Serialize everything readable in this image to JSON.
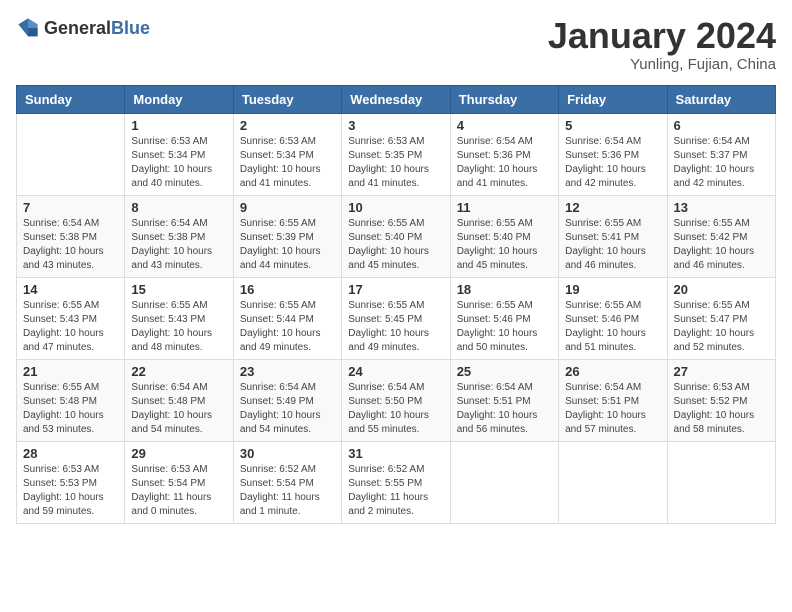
{
  "logo": {
    "general": "General",
    "blue": "Blue"
  },
  "title": "January 2024",
  "subtitle": "Yunling, Fujian, China",
  "header_days": [
    "Sunday",
    "Monday",
    "Tuesday",
    "Wednesday",
    "Thursday",
    "Friday",
    "Saturday"
  ],
  "weeks": [
    [
      {
        "day": "",
        "sunrise": "",
        "sunset": "",
        "daylight": ""
      },
      {
        "day": "1",
        "sunrise": "Sunrise: 6:53 AM",
        "sunset": "Sunset: 5:34 PM",
        "daylight": "Daylight: 10 hours and 40 minutes."
      },
      {
        "day": "2",
        "sunrise": "Sunrise: 6:53 AM",
        "sunset": "Sunset: 5:34 PM",
        "daylight": "Daylight: 10 hours and 41 minutes."
      },
      {
        "day": "3",
        "sunrise": "Sunrise: 6:53 AM",
        "sunset": "Sunset: 5:35 PM",
        "daylight": "Daylight: 10 hours and 41 minutes."
      },
      {
        "day": "4",
        "sunrise": "Sunrise: 6:54 AM",
        "sunset": "Sunset: 5:36 PM",
        "daylight": "Daylight: 10 hours and 41 minutes."
      },
      {
        "day": "5",
        "sunrise": "Sunrise: 6:54 AM",
        "sunset": "Sunset: 5:36 PM",
        "daylight": "Daylight: 10 hours and 42 minutes."
      },
      {
        "day": "6",
        "sunrise": "Sunrise: 6:54 AM",
        "sunset": "Sunset: 5:37 PM",
        "daylight": "Daylight: 10 hours and 42 minutes."
      }
    ],
    [
      {
        "day": "7",
        "sunrise": "Sunrise: 6:54 AM",
        "sunset": "Sunset: 5:38 PM",
        "daylight": "Daylight: 10 hours and 43 minutes."
      },
      {
        "day": "8",
        "sunrise": "Sunrise: 6:54 AM",
        "sunset": "Sunset: 5:38 PM",
        "daylight": "Daylight: 10 hours and 43 minutes."
      },
      {
        "day": "9",
        "sunrise": "Sunrise: 6:55 AM",
        "sunset": "Sunset: 5:39 PM",
        "daylight": "Daylight: 10 hours and 44 minutes."
      },
      {
        "day": "10",
        "sunrise": "Sunrise: 6:55 AM",
        "sunset": "Sunset: 5:40 PM",
        "daylight": "Daylight: 10 hours and 45 minutes."
      },
      {
        "day": "11",
        "sunrise": "Sunrise: 6:55 AM",
        "sunset": "Sunset: 5:40 PM",
        "daylight": "Daylight: 10 hours and 45 minutes."
      },
      {
        "day": "12",
        "sunrise": "Sunrise: 6:55 AM",
        "sunset": "Sunset: 5:41 PM",
        "daylight": "Daylight: 10 hours and 46 minutes."
      },
      {
        "day": "13",
        "sunrise": "Sunrise: 6:55 AM",
        "sunset": "Sunset: 5:42 PM",
        "daylight": "Daylight: 10 hours and 46 minutes."
      }
    ],
    [
      {
        "day": "14",
        "sunrise": "Sunrise: 6:55 AM",
        "sunset": "Sunset: 5:43 PM",
        "daylight": "Daylight: 10 hours and 47 minutes."
      },
      {
        "day": "15",
        "sunrise": "Sunrise: 6:55 AM",
        "sunset": "Sunset: 5:43 PM",
        "daylight": "Daylight: 10 hours and 48 minutes."
      },
      {
        "day": "16",
        "sunrise": "Sunrise: 6:55 AM",
        "sunset": "Sunset: 5:44 PM",
        "daylight": "Daylight: 10 hours and 49 minutes."
      },
      {
        "day": "17",
        "sunrise": "Sunrise: 6:55 AM",
        "sunset": "Sunset: 5:45 PM",
        "daylight": "Daylight: 10 hours and 49 minutes."
      },
      {
        "day": "18",
        "sunrise": "Sunrise: 6:55 AM",
        "sunset": "Sunset: 5:46 PM",
        "daylight": "Daylight: 10 hours and 50 minutes."
      },
      {
        "day": "19",
        "sunrise": "Sunrise: 6:55 AM",
        "sunset": "Sunset: 5:46 PM",
        "daylight": "Daylight: 10 hours and 51 minutes."
      },
      {
        "day": "20",
        "sunrise": "Sunrise: 6:55 AM",
        "sunset": "Sunset: 5:47 PM",
        "daylight": "Daylight: 10 hours and 52 minutes."
      }
    ],
    [
      {
        "day": "21",
        "sunrise": "Sunrise: 6:55 AM",
        "sunset": "Sunset: 5:48 PM",
        "daylight": "Daylight: 10 hours and 53 minutes."
      },
      {
        "day": "22",
        "sunrise": "Sunrise: 6:54 AM",
        "sunset": "Sunset: 5:48 PM",
        "daylight": "Daylight: 10 hours and 54 minutes."
      },
      {
        "day": "23",
        "sunrise": "Sunrise: 6:54 AM",
        "sunset": "Sunset: 5:49 PM",
        "daylight": "Daylight: 10 hours and 54 minutes."
      },
      {
        "day": "24",
        "sunrise": "Sunrise: 6:54 AM",
        "sunset": "Sunset: 5:50 PM",
        "daylight": "Daylight: 10 hours and 55 minutes."
      },
      {
        "day": "25",
        "sunrise": "Sunrise: 6:54 AM",
        "sunset": "Sunset: 5:51 PM",
        "daylight": "Daylight: 10 hours and 56 minutes."
      },
      {
        "day": "26",
        "sunrise": "Sunrise: 6:54 AM",
        "sunset": "Sunset: 5:51 PM",
        "daylight": "Daylight: 10 hours and 57 minutes."
      },
      {
        "day": "27",
        "sunrise": "Sunrise: 6:53 AM",
        "sunset": "Sunset: 5:52 PM",
        "daylight": "Daylight: 10 hours and 58 minutes."
      }
    ],
    [
      {
        "day": "28",
        "sunrise": "Sunrise: 6:53 AM",
        "sunset": "Sunset: 5:53 PM",
        "daylight": "Daylight: 10 hours and 59 minutes."
      },
      {
        "day": "29",
        "sunrise": "Sunrise: 6:53 AM",
        "sunset": "Sunset: 5:54 PM",
        "daylight": "Daylight: 11 hours and 0 minutes."
      },
      {
        "day": "30",
        "sunrise": "Sunrise: 6:52 AM",
        "sunset": "Sunset: 5:54 PM",
        "daylight": "Daylight: 11 hours and 1 minute."
      },
      {
        "day": "31",
        "sunrise": "Sunrise: 6:52 AM",
        "sunset": "Sunset: 5:55 PM",
        "daylight": "Daylight: 11 hours and 2 minutes."
      },
      {
        "day": "",
        "sunrise": "",
        "sunset": "",
        "daylight": ""
      },
      {
        "day": "",
        "sunrise": "",
        "sunset": "",
        "daylight": ""
      },
      {
        "day": "",
        "sunrise": "",
        "sunset": "",
        "daylight": ""
      }
    ]
  ]
}
